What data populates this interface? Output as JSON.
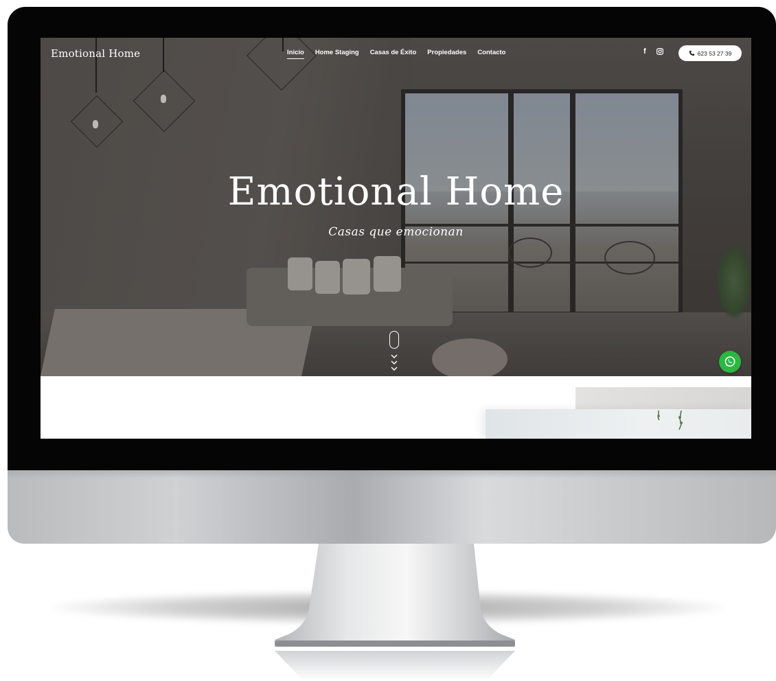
{
  "site": {
    "brand": "Emotional Home"
  },
  "nav": {
    "items": [
      {
        "label": "Inicio",
        "active": true
      },
      {
        "label": "Home Staging",
        "active": false
      },
      {
        "label": "Casas de Éxito",
        "active": false
      },
      {
        "label": "Propiedades",
        "active": false
      },
      {
        "label": "Contacto",
        "active": false
      }
    ]
  },
  "social": {
    "icons": [
      "facebook-icon",
      "instagram-icon"
    ]
  },
  "phone": {
    "label": "623 53 27 39",
    "icon": "phone-icon"
  },
  "hero": {
    "title": "Emotional Home",
    "subtitle": "Casas que emocionan"
  },
  "floating": {
    "whatsapp_icon": "whatsapp-icon",
    "whatsapp_color": "#2bb741"
  },
  "colors": {
    "hero_text": "#ffffff",
    "bezel": "#050505"
  }
}
